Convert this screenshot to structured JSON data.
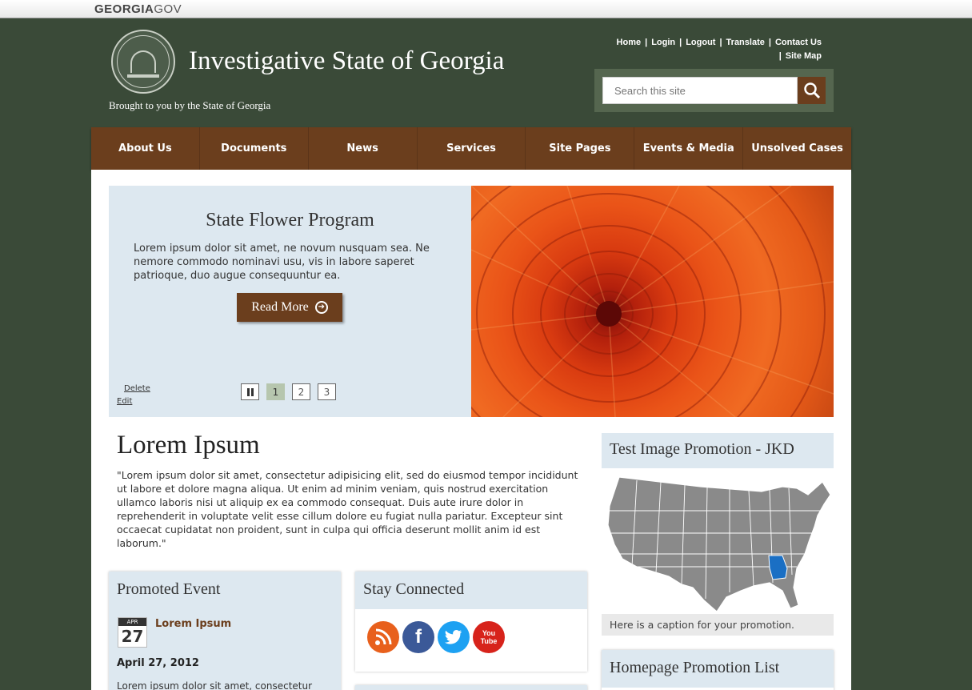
{
  "gov_bar": {
    "brand_bold": "GEORGIA",
    "brand_light": "GOV"
  },
  "header": {
    "site_title": "Investigative State of Georgia",
    "tagline": "Brought to you by the State of Georgia",
    "utility_links": [
      "Home",
      "Login",
      "Logout",
      "Translate",
      "Contact Us",
      "Site Map"
    ],
    "search_placeholder": "Search this site"
  },
  "nav": {
    "items": [
      {
        "label": "About Us"
      },
      {
        "label": "Documents"
      },
      {
        "label": "News"
      },
      {
        "label": "Services"
      },
      {
        "label": "Site Pages"
      },
      {
        "label": "Events & Media"
      },
      {
        "label": "Unsolved Cases"
      }
    ]
  },
  "slider": {
    "title": "State Flower Program",
    "text": "Lorem ipsum dolor sit amet, ne novum nusquam sea. Ne nemore commodo nominavi usu, vis in labore saperet patrioque, duo augue consequuntur ea.",
    "button_label": "Read More",
    "admin_delete": "Delete",
    "admin_edit": "Edit",
    "pages": [
      "1",
      "2",
      "3"
    ],
    "active_page": "1"
  },
  "article": {
    "title": "Lorem Ipsum",
    "body": "\"Lorem ipsum dolor sit amet, consectetur adipisicing elit, sed do eiusmod tempor incididunt ut labore et dolore magna aliqua. Ut enim ad minim veniam, quis nostrud exercitation ullamco laboris nisi ut aliquip ex ea commodo consequat. Duis aute irure dolor in reprehenderit in voluptate velit esse cillum dolore eu fugiat nulla pariatur. Excepteur sint occaecat cupidatat non proident, sunt in culpa qui officia deserunt mollit anim id est laborum.\""
  },
  "promoted_event": {
    "heading": "Promoted Event",
    "month": "APR",
    "day": "27",
    "name": "Lorem Ipsum",
    "date": "April 27, 2012",
    "text": "Lorem ipsum dolor sit amet, consectetur"
  },
  "stay_connected": {
    "heading": "Stay Connected",
    "icons": [
      "rss-icon",
      "facebook-icon",
      "twitter-icon",
      "youtube-icon"
    ],
    "youtube_glyph_top": "You",
    "youtube_glyph_bottom": "Tube"
  },
  "promo": {
    "title": "Test Image Promotion - JKD",
    "caption": "Here is a caption for your promotion.",
    "highlight_state": "Georgia",
    "highlight_color": "#1a6fc4"
  },
  "homepage_promo_list": {
    "heading": "Homepage Promotion List"
  },
  "colors": {
    "brown": "#6b3e1d",
    "green_bg": "#3a4a38",
    "light_blue": "#dde8f0"
  }
}
